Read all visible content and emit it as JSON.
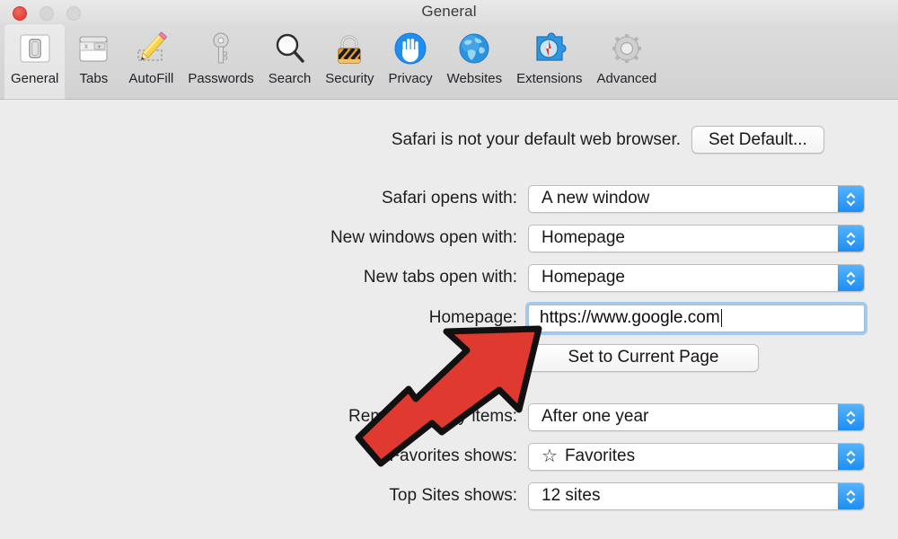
{
  "window": {
    "title": "General",
    "controls": [
      {
        "name": "close",
        "color": "#e0443a"
      },
      {
        "name": "minimize",
        "color": "#d6d6d6"
      },
      {
        "name": "zoom",
        "color": "#d6d6d6"
      }
    ]
  },
  "toolbar": {
    "selected": "General",
    "tabs": [
      {
        "label": "General",
        "icon": "switch-icon"
      },
      {
        "label": "Tabs",
        "icon": "tabs-icon"
      },
      {
        "label": "AutoFill",
        "icon": "pencil-icon"
      },
      {
        "label": "Passwords",
        "icon": "key-icon"
      },
      {
        "label": "Search",
        "icon": "magnifier-icon"
      },
      {
        "label": "Security",
        "icon": "padlock-icon"
      },
      {
        "label": "Privacy",
        "icon": "hand-icon"
      },
      {
        "label": "Websites",
        "icon": "globe-icon"
      },
      {
        "label": "Extensions",
        "icon": "puzzle-icon"
      },
      {
        "label": "Advanced",
        "icon": "gear-icon"
      }
    ]
  },
  "notice": {
    "text": "Safari is not your default web browser.",
    "button_label": "Set Default..."
  },
  "settings": {
    "safari_opens_with": {
      "label": "Safari opens with:",
      "value": "A new window"
    },
    "new_windows_open_with": {
      "label": "New windows open with:",
      "value": "Homepage"
    },
    "new_tabs_open_with": {
      "label": "New tabs open with:",
      "value": "Homepage"
    },
    "homepage": {
      "label": "Homepage:",
      "value": "https://www.google.com",
      "button_label": "Set to Current Page",
      "focused": true
    },
    "remove_history_items": {
      "label": "Remove history items:",
      "value": "After one year"
    },
    "favorites_shows": {
      "label": "Favorites shows:",
      "icon": "star-icon",
      "value": "Favorites"
    },
    "top_sites_shows": {
      "label": "Top Sites shows:",
      "value": "12 sites"
    }
  },
  "annotation": {
    "arrow_color": "#e03a30",
    "arrow_outline": "#111111",
    "points_to": "homepage-input"
  }
}
